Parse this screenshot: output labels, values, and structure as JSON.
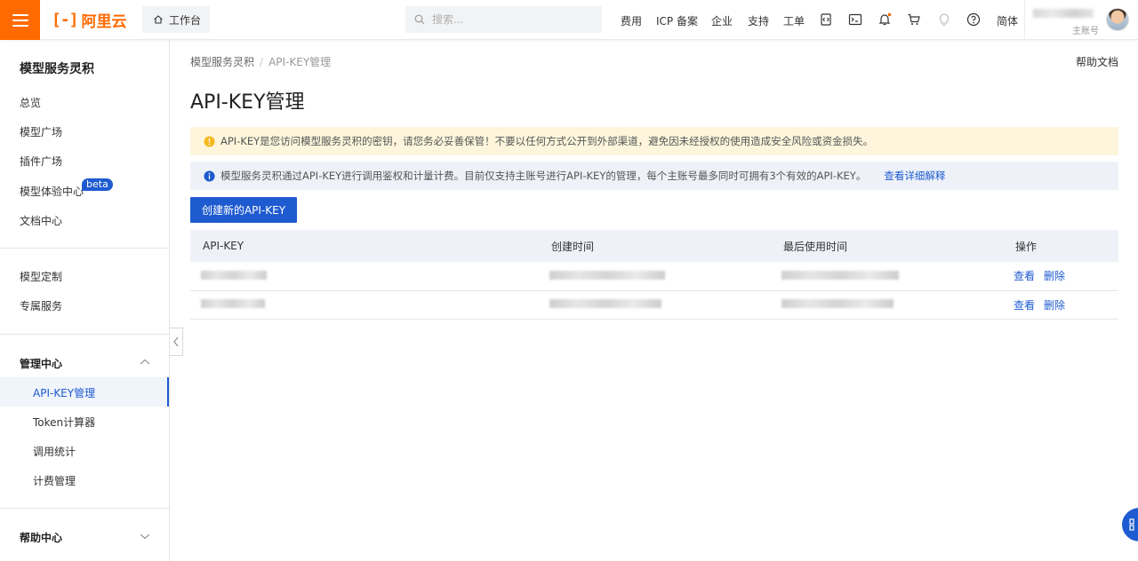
{
  "topbar": {
    "brand": "阿里云",
    "workbench": "工作台",
    "search_placeholder": "搜索...",
    "links": [
      "费用",
      "ICP 备案",
      "企业",
      "支持",
      "工单"
    ],
    "lang": "简体",
    "account_role": "主账号"
  },
  "sidebar": {
    "title": "模型服务灵积",
    "items": [
      "总览",
      "模型广场",
      "插件广场",
      "模型体验中心",
      "文档中心"
    ],
    "beta_badge": "beta",
    "items2": [
      "模型定制",
      "专属服务"
    ],
    "manage_group": "管理中心",
    "manage_items": [
      "API-KEY管理",
      "Token计算器",
      "调用统计",
      "计费管理"
    ],
    "help_group": "帮助中心"
  },
  "main": {
    "breadcrumb": [
      "模型服务灵积",
      "API-KEY管理"
    ],
    "help_doc": "帮助文档",
    "title": "API-KEY管理",
    "warning": "API-KEY是您访问模型服务灵积的密钥，请您务必妥善保管！不要以任何方式公开到外部渠道，避免因未经授权的使用造成安全风险或资金损失。",
    "info": "模型服务灵积通过API-KEY进行调用鉴权和计量计费。目前仅支持主账号进行API-KEY的管理，每个主账号最多同时可拥有3个有效的API-KEY。",
    "info_link": "查看详细解释",
    "create_button": "创建新的API-KEY",
    "table": {
      "headers": [
        "API-KEY",
        "创建时间",
        "最后使用时间",
        "操作"
      ],
      "actions": [
        "查看",
        "删除"
      ]
    }
  },
  "colors": {
    "accent": "#1e5bd0",
    "brand": "#ff6a00",
    "warn_bg": "#fdf6dc",
    "info_bg": "#eef2f8"
  }
}
